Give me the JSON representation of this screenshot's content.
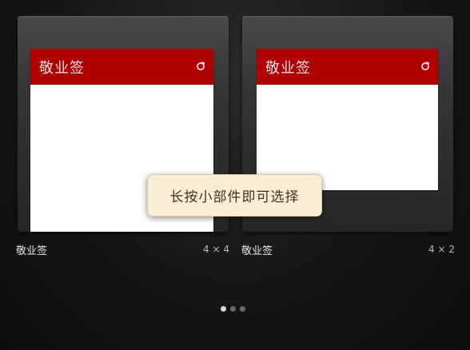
{
  "widgets": [
    {
      "title": "敬业签",
      "caption": "敬业签",
      "size": "4 × 4",
      "header_color": "#b00000"
    },
    {
      "title": "敬业签",
      "caption": "敬业签",
      "size": "4 × 2",
      "header_color": "#b00000"
    }
  ],
  "toast": {
    "text": "长按小部件即可选择"
  },
  "pager": {
    "page_count": 3,
    "current_page": 1
  },
  "icons": {
    "refresh": "refresh-icon"
  }
}
